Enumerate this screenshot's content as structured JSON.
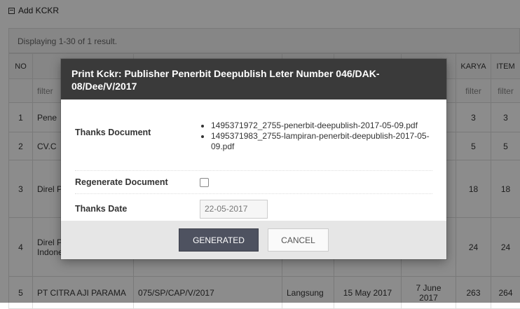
{
  "page": {
    "add_link": "Add KCKR",
    "summary": "Displaying 1-30 of 1 result.",
    "filter_placeholder": "filter",
    "columns": {
      "no": "NO",
      "karya": "KARYA",
      "item": "ITEM"
    },
    "rows": [
      {
        "no": "1",
        "publisher": "Pene",
        "karya": "3",
        "item": "3"
      },
      {
        "no": "2",
        "publisher": "CV.C",
        "karya": "5",
        "item": "5"
      },
      {
        "no": "3",
        "publisher": "Direl Perpu Unive Indor",
        "karya": "18",
        "item": "18"
      },
      {
        "no": "4",
        "publisher": "Direl Perpu Unive Indonesia",
        "karya": "24",
        "item": "24"
      },
      {
        "no": "5",
        "publisher": "PT CITRA AJI PARAMA",
        "letter": "075/SP/CAP/V/2017",
        "delivery": "Langsung",
        "date1": "15 May 2017",
        "date2": "7 June 2017",
        "karya": "263",
        "item": "264"
      }
    ]
  },
  "modal": {
    "title": "Print Kckr: Publisher Penerbit Deepublish Leter Number 046/DAK-08/Dee/V/2017",
    "thanks_document_label": "Thanks Document",
    "documents": [
      "1495371972_2755-penerbit-deepublish-2017-05-09.pdf",
      "1495371983_2755-lampiran-penerbit-deepublish-2017-05-09.pdf"
    ],
    "regenerate_label": "Regenerate Document",
    "regenerate_checked": false,
    "thanks_date_label": "Thanks Date",
    "thanks_date_value": "22-05-2017",
    "generated_button": "GENERATED",
    "cancel_button": "CANCEL"
  }
}
